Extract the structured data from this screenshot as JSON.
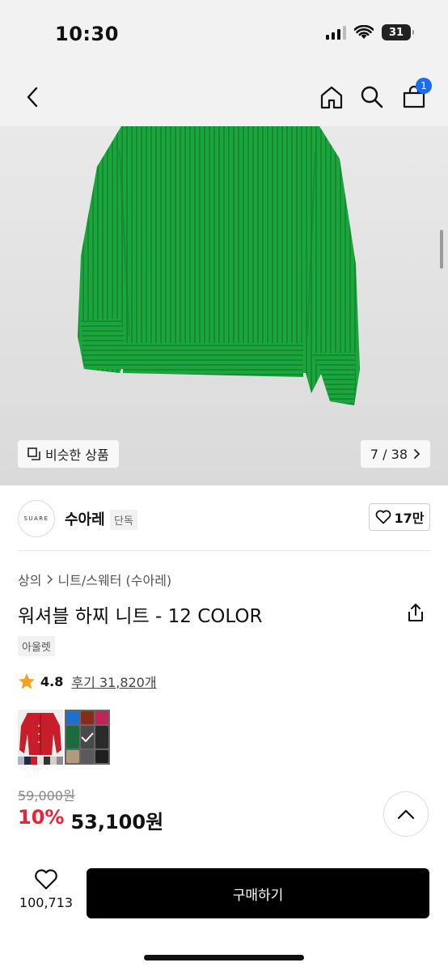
{
  "status_bar": {
    "time": "10:30",
    "battery": "31"
  },
  "nav": {
    "cart_count": "1"
  },
  "hero": {
    "similar_label": "비슷한 상품",
    "counter": "7 / 38"
  },
  "brand": {
    "logo_text": "SUARE",
    "name": "수아레",
    "tag": "단독",
    "likes": "17만"
  },
  "breadcrumb": {
    "category": "상의",
    "subcategory": "니트/스웨터 (수아레)"
  },
  "product": {
    "title": "워셔블 하찌 니트 - 12 COLOR",
    "tag": "아울렛",
    "rating": "4.8",
    "reviews": "후기 31,820개",
    "original_price": "59,000원",
    "discount": "10%",
    "sale_price": "53,100원"
  },
  "swatch_colors": [
    "#1f6fd1",
    "#8a2b1a",
    "#c0245a",
    "#1c6b3a",
    "#3c3c3c",
    "#2b2b2b",
    "#b49a7c",
    "#5a5a5a",
    "#1e1e1e"
  ],
  "colors": {
    "accent": "#1a6cf5",
    "discount": "#e8233a",
    "product_green": "#19a33c"
  },
  "bottom_bar": {
    "wish_count": "100,713",
    "buy_label": "구매하기"
  }
}
